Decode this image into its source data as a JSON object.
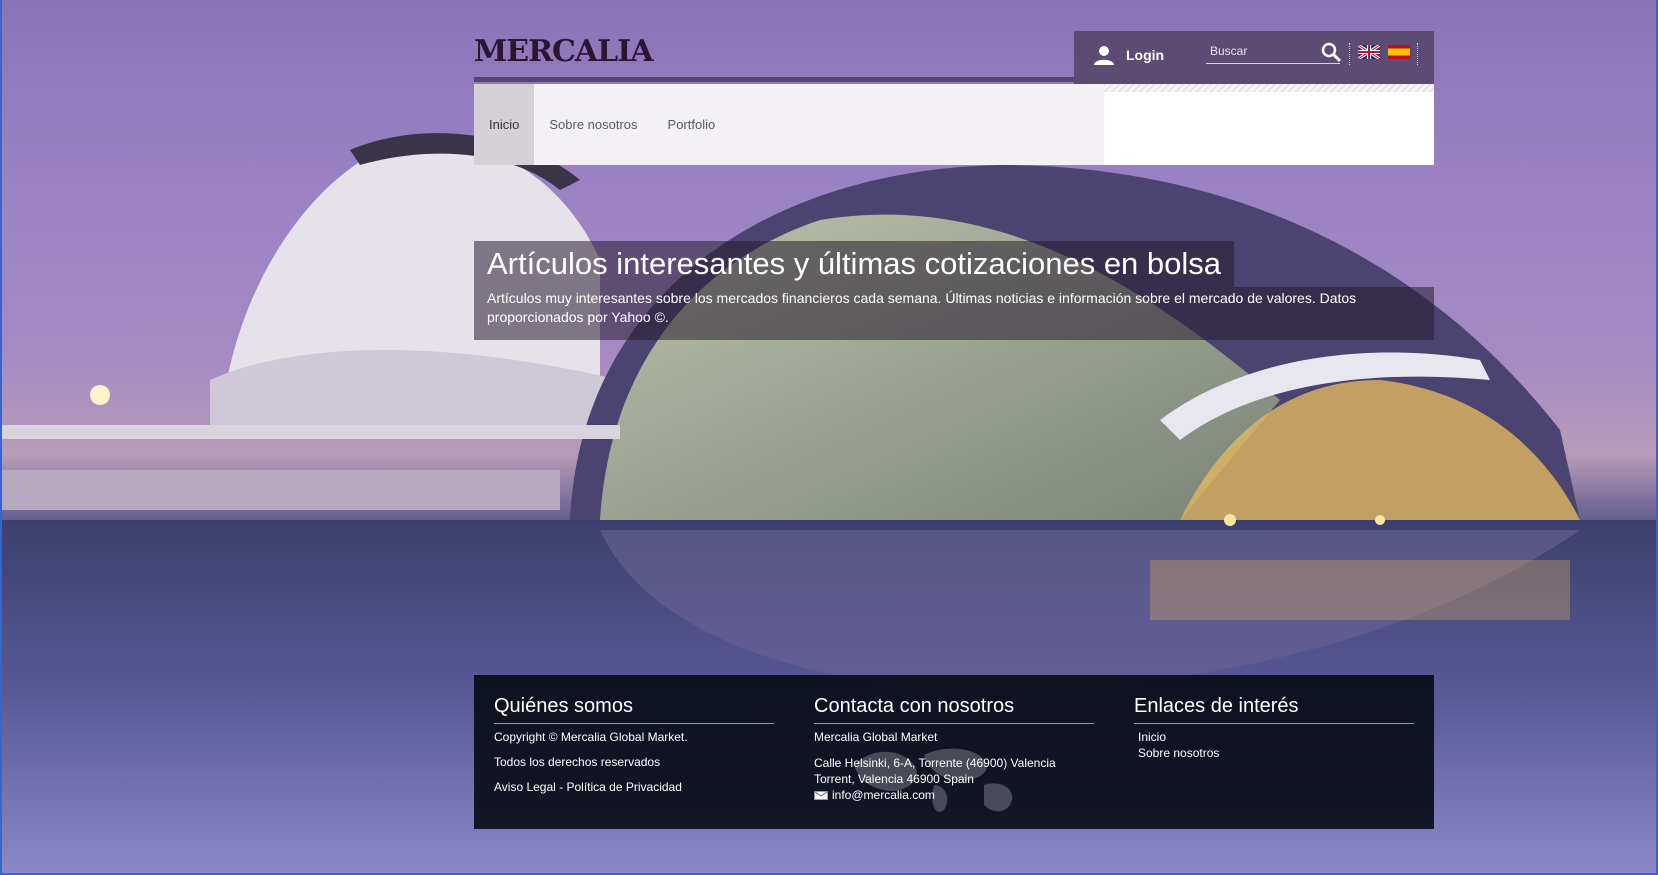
{
  "brand": {
    "logo": "MERCALIA"
  },
  "header": {
    "login_label": "Login",
    "search_placeholder": "Buscar"
  },
  "nav": {
    "items": [
      {
        "label": "Inicio",
        "active": true
      },
      {
        "label": "Sobre nosotros",
        "active": false
      },
      {
        "label": "Portfolio",
        "active": false
      }
    ]
  },
  "hero": {
    "title": "Artículos interesantes y últimas cotizaciones en bolsa",
    "description": "Artículos muy interesantes sobre los mercados financieros cada semana. Últimas noticias e información sobre el mercado de valores. Datos proporcionados por Yahoo ©."
  },
  "footer": {
    "about": {
      "title": "Quiénes somos",
      "copyright": "Copyright © Mercalia Global Market.",
      "rights": "Todos los derechos reservados",
      "legal": "Aviso Legal - Política de Privacidad"
    },
    "contact": {
      "title": "Contacta con nosotros",
      "company": "Mercalia Global Market",
      "address1": "Calle Helsinki, 6-A, Torrente (46900) Valencia",
      "address2": "Torrent, Valencia 46900 Spain",
      "email": "info@mercalia.com"
    },
    "links": {
      "title": "Enlaces de interés",
      "items": [
        "Inicio",
        "Sobre nosotros"
      ]
    }
  },
  "colors": {
    "header_bar": "#5c4b72",
    "footer_bg": "#05080f",
    "logo": "#2a1630"
  },
  "icons": [
    "user-icon",
    "search-icon",
    "flag-uk-icon",
    "flag-es-icon",
    "mail-icon",
    "world-map-icon"
  ]
}
